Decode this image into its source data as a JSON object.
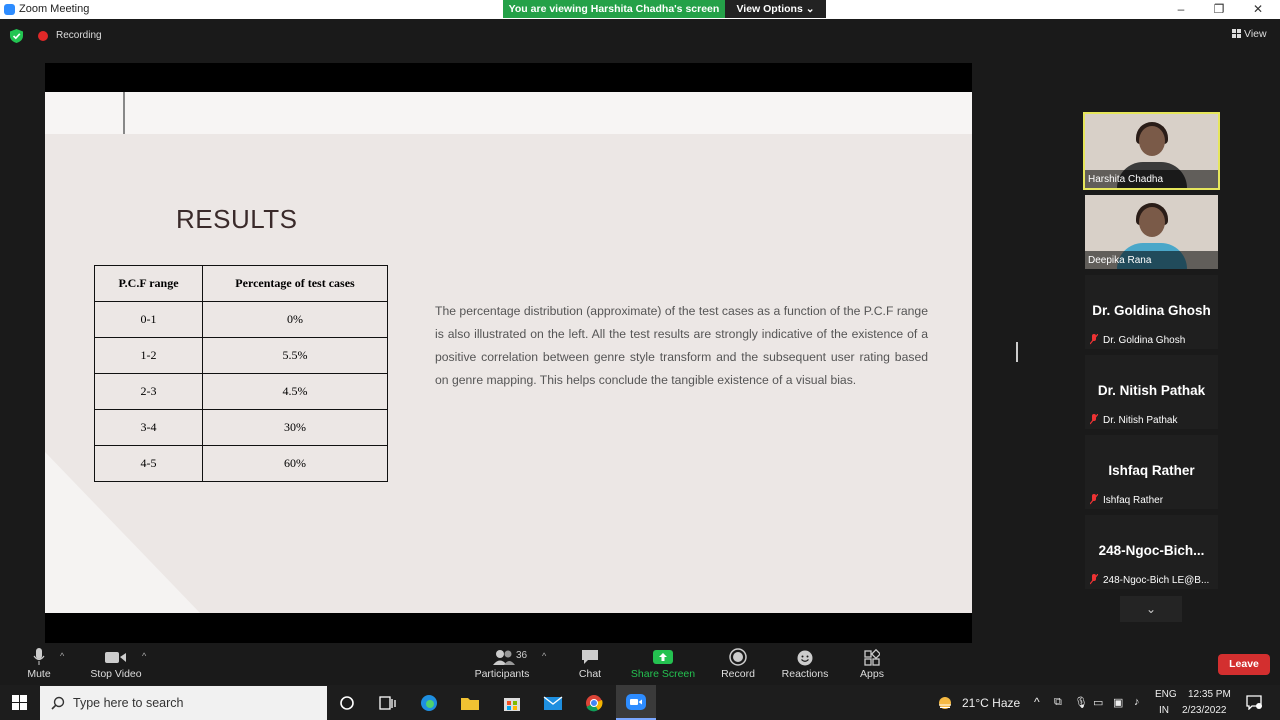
{
  "window": {
    "title": "Zoom Meeting",
    "viewing_banner": "You are viewing Harshita Chadha's screen",
    "view_options": "View Options ⌄"
  },
  "status": {
    "recording": "Recording",
    "view": "View"
  },
  "slide": {
    "title": "RESULTS",
    "table": {
      "headers": [
        "P.C.F range",
        "Percentage of test cases"
      ],
      "rows": [
        [
          "0-1",
          "0%"
        ],
        [
          "1-2",
          "5.5%"
        ],
        [
          "2-3",
          "4.5%"
        ],
        [
          "3-4",
          "30%"
        ],
        [
          "4-5",
          "60%"
        ]
      ]
    },
    "body": "The percentage distribution (approximate) of the test cases as a function of the P.C.F range is also illustrated on the left. All the test results are strongly indicative of the existence of a positive correlation between genre style transform and the subsequent user rating based on genre mapping. This helps conclude the tangible existence of a visual bias."
  },
  "participants": [
    {
      "name": "Harshita Chadha",
      "video": true,
      "active": true
    },
    {
      "name": "Deepika Rana",
      "video": true,
      "active": false
    },
    {
      "display": "Dr. Goldina Ghosh",
      "name": "Dr. Goldina Ghosh",
      "muted": true
    },
    {
      "display": "Dr. Nitish Pathak",
      "name": "Dr. Nitish Pathak",
      "muted": true
    },
    {
      "display": "Ishfaq Rather",
      "name": "Ishfaq Rather",
      "muted": true
    },
    {
      "display": "248-Ngoc-Bich...",
      "name": "248-Ngoc-Bich LE@B...",
      "muted": true
    }
  ],
  "toolbar": {
    "mute": "Mute",
    "stop_video": "Stop Video",
    "participants": "Participants",
    "participants_count": "36",
    "chat": "Chat",
    "share_screen": "Share Screen",
    "record": "Record",
    "reactions": "Reactions",
    "apps": "Apps",
    "leave": "Leave"
  },
  "taskbar": {
    "search_placeholder": "Type here to search",
    "weather": "21°C  Haze",
    "lang1": "ENG",
    "lang2": "IN",
    "time": "12:35 PM",
    "date": "2/23/2022"
  },
  "colors": {
    "share_green": "#24a148",
    "leave_red": "#d32f2f",
    "active_speaker": "#e6e65c",
    "zoom_blue": "#2d8cff"
  }
}
